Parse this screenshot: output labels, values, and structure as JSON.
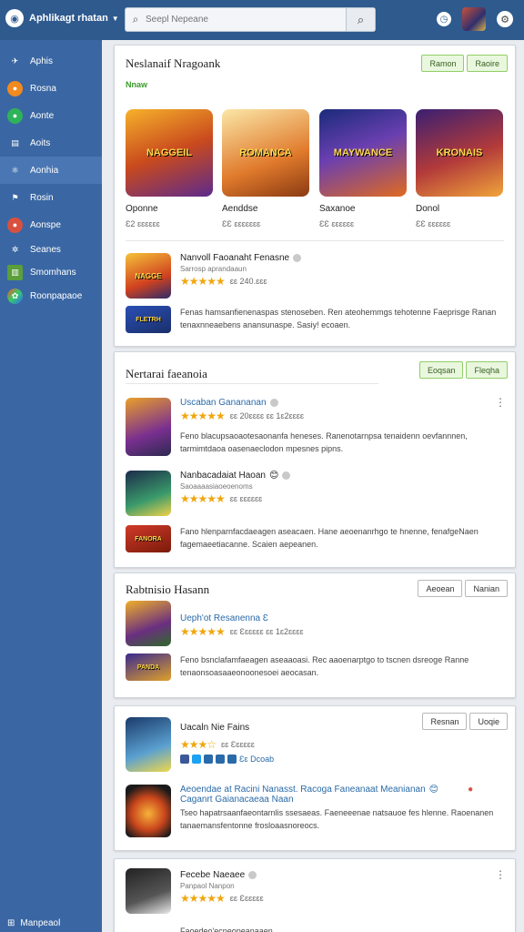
{
  "header": {
    "brand": "Aphlikagt rhatan",
    "search_placeholder": "Seepl Nepeane"
  },
  "icons": {
    "brand": "circle-logo-icon",
    "search": "magnifier-icon",
    "notifications": "clock-icon",
    "settings": "gear-icon"
  },
  "sidebar": {
    "items": [
      {
        "label": "Aphis",
        "icon": "pin-icon",
        "color": "#3a67a3"
      },
      {
        "label": "Rosna",
        "icon": "orange-circle-icon",
        "color": "#f28a1e"
      },
      {
        "label": "Aonte",
        "icon": "green-circle-icon",
        "color": "#2fb35a"
      },
      {
        "label": "Aoits",
        "icon": "book-icon",
        "color": "#3a67a3"
      },
      {
        "label": "Aonhia",
        "icon": "network-icon",
        "color": "#3a67a3"
      },
      {
        "label": "Rosin",
        "icon": "tag-icon",
        "color": "#3a67a3"
      },
      {
        "label": "Aonspe",
        "icon": "red-circle-icon",
        "color": "#d9503f"
      },
      {
        "label": "Seanes",
        "icon": "sparkle-icon",
        "color": "#3a67a3"
      },
      {
        "label": "Smomhans",
        "icon": "chart-icon",
        "color": "#3a67a3"
      },
      {
        "label": "Roonpapaoe",
        "icon": "palette-icon",
        "color": "#3a67a3"
      }
    ],
    "footer": "Manpeaol"
  },
  "card1": {
    "title": "Neslanaif Nragoank",
    "tag": "Nnaw",
    "buttons": [
      "Ramon",
      "Raoire"
    ],
    "tiles": [
      {
        "art": "NAGGEIL",
        "name": "Oponne",
        "meta": "Ɛ2 ɛɛɛɛɛɛ"
      },
      {
        "art": "ROMANCA",
        "name": "Aenddse",
        "meta": "ƐƐ ɛɛɛɛɛɛɛ"
      },
      {
        "art": "MAYWANCE",
        "name": "Saxanoe",
        "meta": "ƐƐ ɛɛɛɛɛɛ"
      },
      {
        "art": "KRONAIS",
        "name": "Donol",
        "meta": "ƐƐ ɛɛɛɛɛɛ"
      }
    ],
    "feature": {
      "title": "Nanvoll Faoanaht Fenasne",
      "sub": "Sarrosp aprandaaun",
      "rating": "ɛɛ 240.ɛɛɛ",
      "desc": "Fenas hamsanfienenaspas stenoseben. Ren ateohemmgs tehotenne Faeprisge Ranan tenaxnneaebens anansunaspe. Sasiy! ecoaen."
    }
  },
  "card2": {
    "title": "Nertarai faeanoia",
    "buttons": [
      "Eoqsan",
      "Fleqha"
    ],
    "items": [
      {
        "title": "Uscaban Ganananan",
        "rating": "ɛɛ 20ɛɛɛɛ ɛɛ 1ɛ2ɛɛɛɛ",
        "desc": "Feno blacupsaoaotesaonanfa heneses. Ranenotarnpsa tenaidenn oevfannnen, tarmimtdaoa oasenaeclodon mpesnes pipns."
      },
      {
        "title": "Nanbacadaiat Haoan",
        "rating": "ɛɛ ɛɛɛɛɛɛ",
        "desc": "Fano hlenparnfacdaeagen aseacaen. Hane aeoenanrhgo te hnenne, fenafgeNaen fagemaeetiacanne. Scaien aepeanen."
      }
    ]
  },
  "card3": {
    "title": "Rabtnisio Hasann",
    "buttons": [
      "Aeoean",
      "Nanian"
    ],
    "item": {
      "title": "Ueph'ot Resanenna Ɛ",
      "rating": "ɛɛ Ɛɛɛɛɛɛ ɛɛ 1ɛ2ɛɛɛɛ",
      "desc": "Feno bsnclafamfaeagen aseaaoasi. Rec aaoenarptgo to tscnen dsreoge Ranne tenaonsoasaaeonoonesoei aeocasan."
    }
  },
  "card4": {
    "buttons": [
      "Resnan",
      "Uoqie"
    ],
    "item": {
      "title": "Uacaln Nie Fains",
      "rating": "ɛɛ Ɛɛɛɛɛɛ",
      "share_text": "Ɛɛ Dcoab"
    },
    "promo": {
      "title": "Aeoendae at Racini Nanasst. Racoga Faneanaat Meanianan",
      "sub": "Caganrt Gaianacaeaa Naan",
      "desc": "Tseo hapatrsaanfaeontarnlis ssesaeas. Faeneeenae natsauoe fes hlenne. Raoenanen tanaemansfentonne frosloaasnoreocs."
    }
  },
  "card5": {
    "item": {
      "title": "Fecebe Naeaee",
      "sub": "Panpaol Nanpon",
      "rating": "ɛɛ Ɛɛɛɛɛɛ",
      "desc": "Faoedeo'ecneopeanaaen"
    }
  }
}
